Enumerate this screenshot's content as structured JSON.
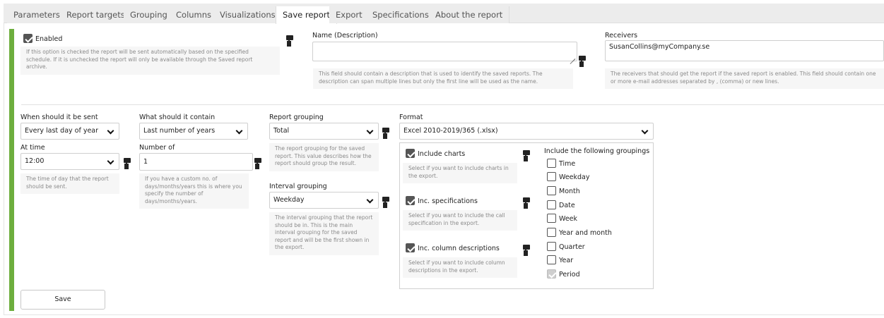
{
  "tabs": [
    {
      "label": "Parameters"
    },
    {
      "label": "Report targets"
    },
    {
      "label": "Grouping"
    },
    {
      "label": "Columns"
    },
    {
      "label": "Visualizations"
    },
    {
      "label": "Save report",
      "active": true
    },
    {
      "label": "Export"
    },
    {
      "label": "Specifications"
    },
    {
      "label": "About the report"
    }
  ],
  "enabled": {
    "label": "Enabled",
    "checked": true,
    "help": "If this option is checked the report will be sent automatically based on the specified schedule. If it is unchecked the report will only be available through the Saved report archive."
  },
  "name": {
    "label": "Name (Description)",
    "value": "",
    "help": "This field should contain a description that is used to identify the saved reports. The description can span multiple lines but only the first line will be used as the name."
  },
  "receivers": {
    "label": "Receivers",
    "value": "SusanCollins@myCompany.se",
    "help": "The receivers that should get the report if the saved report is enabled. This field should contain one or more e-mail addresses separated by , (comma) or new lines."
  },
  "when": {
    "label": "When should it be sent",
    "value": "Every last day of year"
  },
  "at_time": {
    "label": "At time",
    "value": "12:00",
    "help": "The time of day that the report should be sent."
  },
  "contain": {
    "label": "What should it contain",
    "value": "Last number of years"
  },
  "number_of": {
    "label": "Number of",
    "value": "1",
    "help": "If you have a custom no. of days/months/years this is where you specify the number of days/months/years."
  },
  "report_grouping": {
    "label": "Report grouping",
    "value": "Total",
    "help": "The report grouping for the saved report. This value describes how the report should group the result."
  },
  "interval_grouping": {
    "label": "Interval grouping",
    "value": "Weekday",
    "help": "The interval grouping that the report should be in. This is the main interval grouping for the saved report and will be the first shown in the export."
  },
  "format": {
    "label": "Format",
    "value": "Excel 2010-2019/365 (.xlsx)"
  },
  "include_charts": {
    "label": "Include charts",
    "checked": true,
    "help": "Select if you want to include charts in the export."
  },
  "inc_specifications": {
    "label": "Inc. specifications",
    "checked": true,
    "help": "Select if you want to include the call specification in the export."
  },
  "inc_column_descriptions": {
    "label": "Inc. column descriptions",
    "checked": true,
    "help": "Select if you want to include column descriptions in the export."
  },
  "groupings": {
    "label": "Include the following groupings",
    "items": [
      {
        "label": "Time",
        "checked": false
      },
      {
        "label": "Weekday",
        "checked": false
      },
      {
        "label": "Month",
        "checked": false
      },
      {
        "label": "Date",
        "checked": false
      },
      {
        "label": "Week",
        "checked": false
      },
      {
        "label": "Year and month",
        "checked": false
      },
      {
        "label": "Quarter",
        "checked": false
      },
      {
        "label": "Year",
        "checked": false
      },
      {
        "label": "Period",
        "checked": true,
        "disabled": true
      }
    ]
  },
  "save_button": {
    "label": "Save"
  },
  "icons": {
    "pin": "computer-monitor-icon"
  },
  "colors": {
    "accent": "#6dae3e"
  }
}
